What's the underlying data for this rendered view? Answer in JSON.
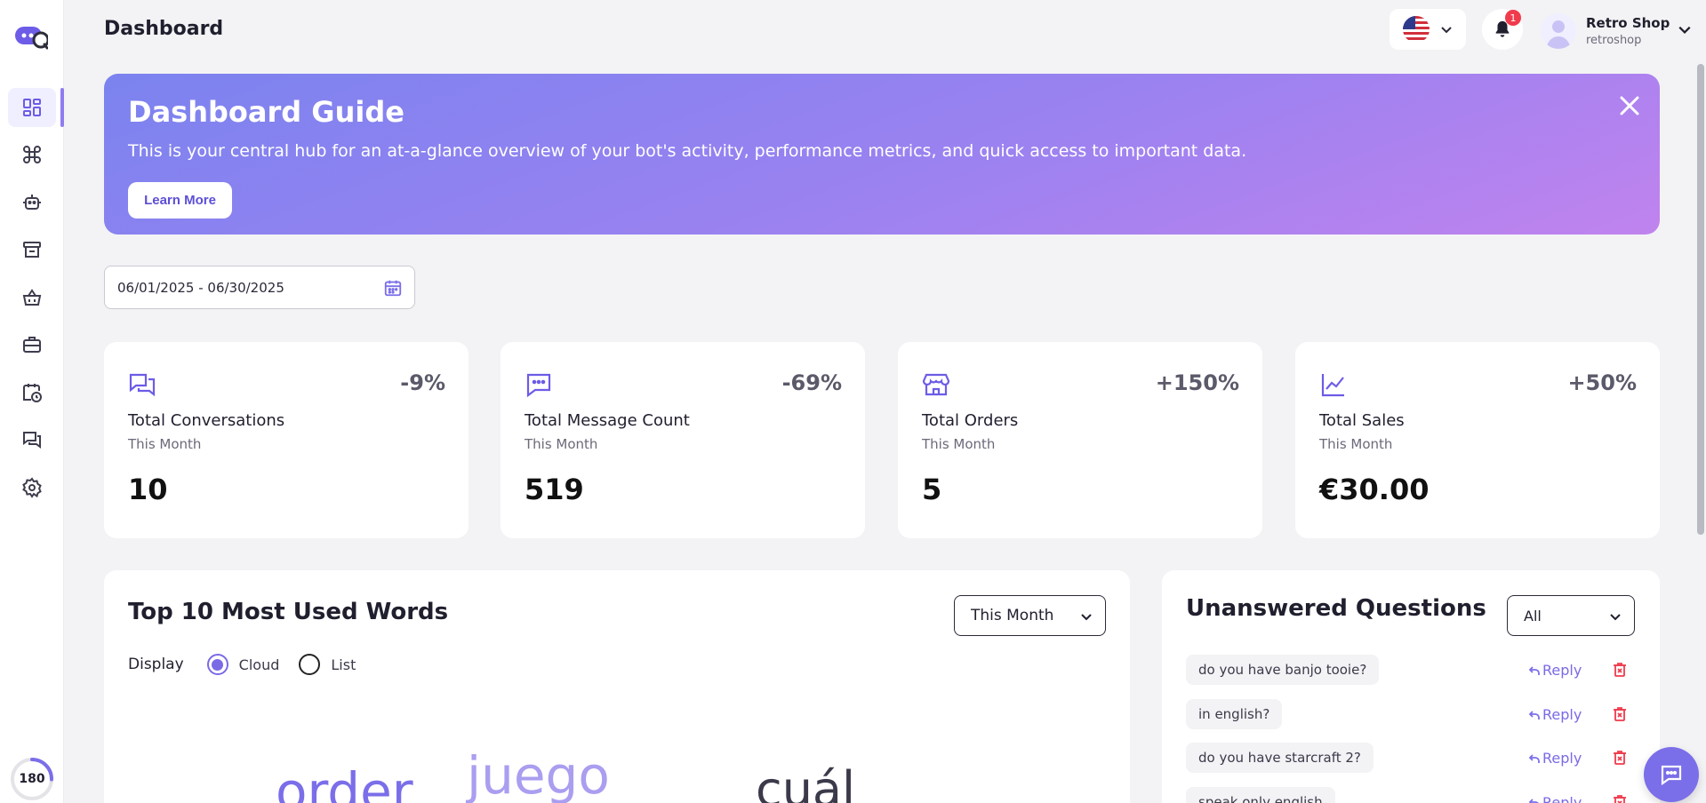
{
  "app": {
    "page_title": "Dashboard",
    "credits": "180"
  },
  "sidebar": {
    "items": [
      {
        "icon": "dashboard-grid-icon",
        "active": true
      },
      {
        "icon": "command-icon",
        "active": false
      },
      {
        "icon": "bot-icon",
        "active": false
      },
      {
        "icon": "store-icon",
        "active": false
      },
      {
        "icon": "basket-icon",
        "active": false
      },
      {
        "icon": "briefcase-icon",
        "active": false
      },
      {
        "icon": "calendar-clock-icon",
        "active": false
      },
      {
        "icon": "chat-bubbles-icon",
        "active": false
      },
      {
        "icon": "settings-gear-icon",
        "active": false
      }
    ]
  },
  "topbar": {
    "language_flag": "us-flag-icon",
    "notification_count": "1",
    "user_name": "Retro Shop",
    "user_handle": "retroshop"
  },
  "guide": {
    "title": "Dashboard Guide",
    "text": "This is your central hub for an at-a-glance overview of your bot's activity, performance metrics, and quick access to important data.",
    "button_label": "Learn More"
  },
  "date_range": "06/01/2025 - 06/30/2025",
  "stats": [
    {
      "label": "Total Conversations",
      "period": "This Month",
      "value": "10",
      "change": "-9%",
      "icon": "conversations-icon"
    },
    {
      "label": "Total Message Count",
      "period": "This Month",
      "value": "519",
      "change": "-69%",
      "icon": "message-dots-icon"
    },
    {
      "label": "Total Orders",
      "period": "This Month",
      "value": "5",
      "change": "+150%",
      "icon": "store-icon"
    },
    {
      "label": "Total Sales",
      "period": "This Month",
      "value": "€30.00",
      "change": "+50%",
      "icon": "line-chart-icon"
    }
  ],
  "words": {
    "title": "Top 10 Most Used Words",
    "period": "This Month",
    "display_label": "Display",
    "option_cloud": "Cloud",
    "option_list": "List",
    "selected": "Cloud",
    "cloud": [
      {
        "text": "order",
        "color": "#7b6ee9"
      },
      {
        "text": "juego",
        "color": "#a99ef0"
      },
      {
        "text": "cuál",
        "color": "#3a3a4a"
      }
    ]
  },
  "questions": {
    "title": "Unanswered Questions",
    "filter": "All",
    "reply_label": "Reply",
    "items": [
      {
        "text": "do you have banjo tooie?"
      },
      {
        "text": "in english?"
      },
      {
        "text": "do you have starcraft 2?"
      },
      {
        "text": "speak only english"
      }
    ]
  },
  "colors": {
    "accent": "#7b6ee9",
    "danger": "#ef3b4c"
  }
}
